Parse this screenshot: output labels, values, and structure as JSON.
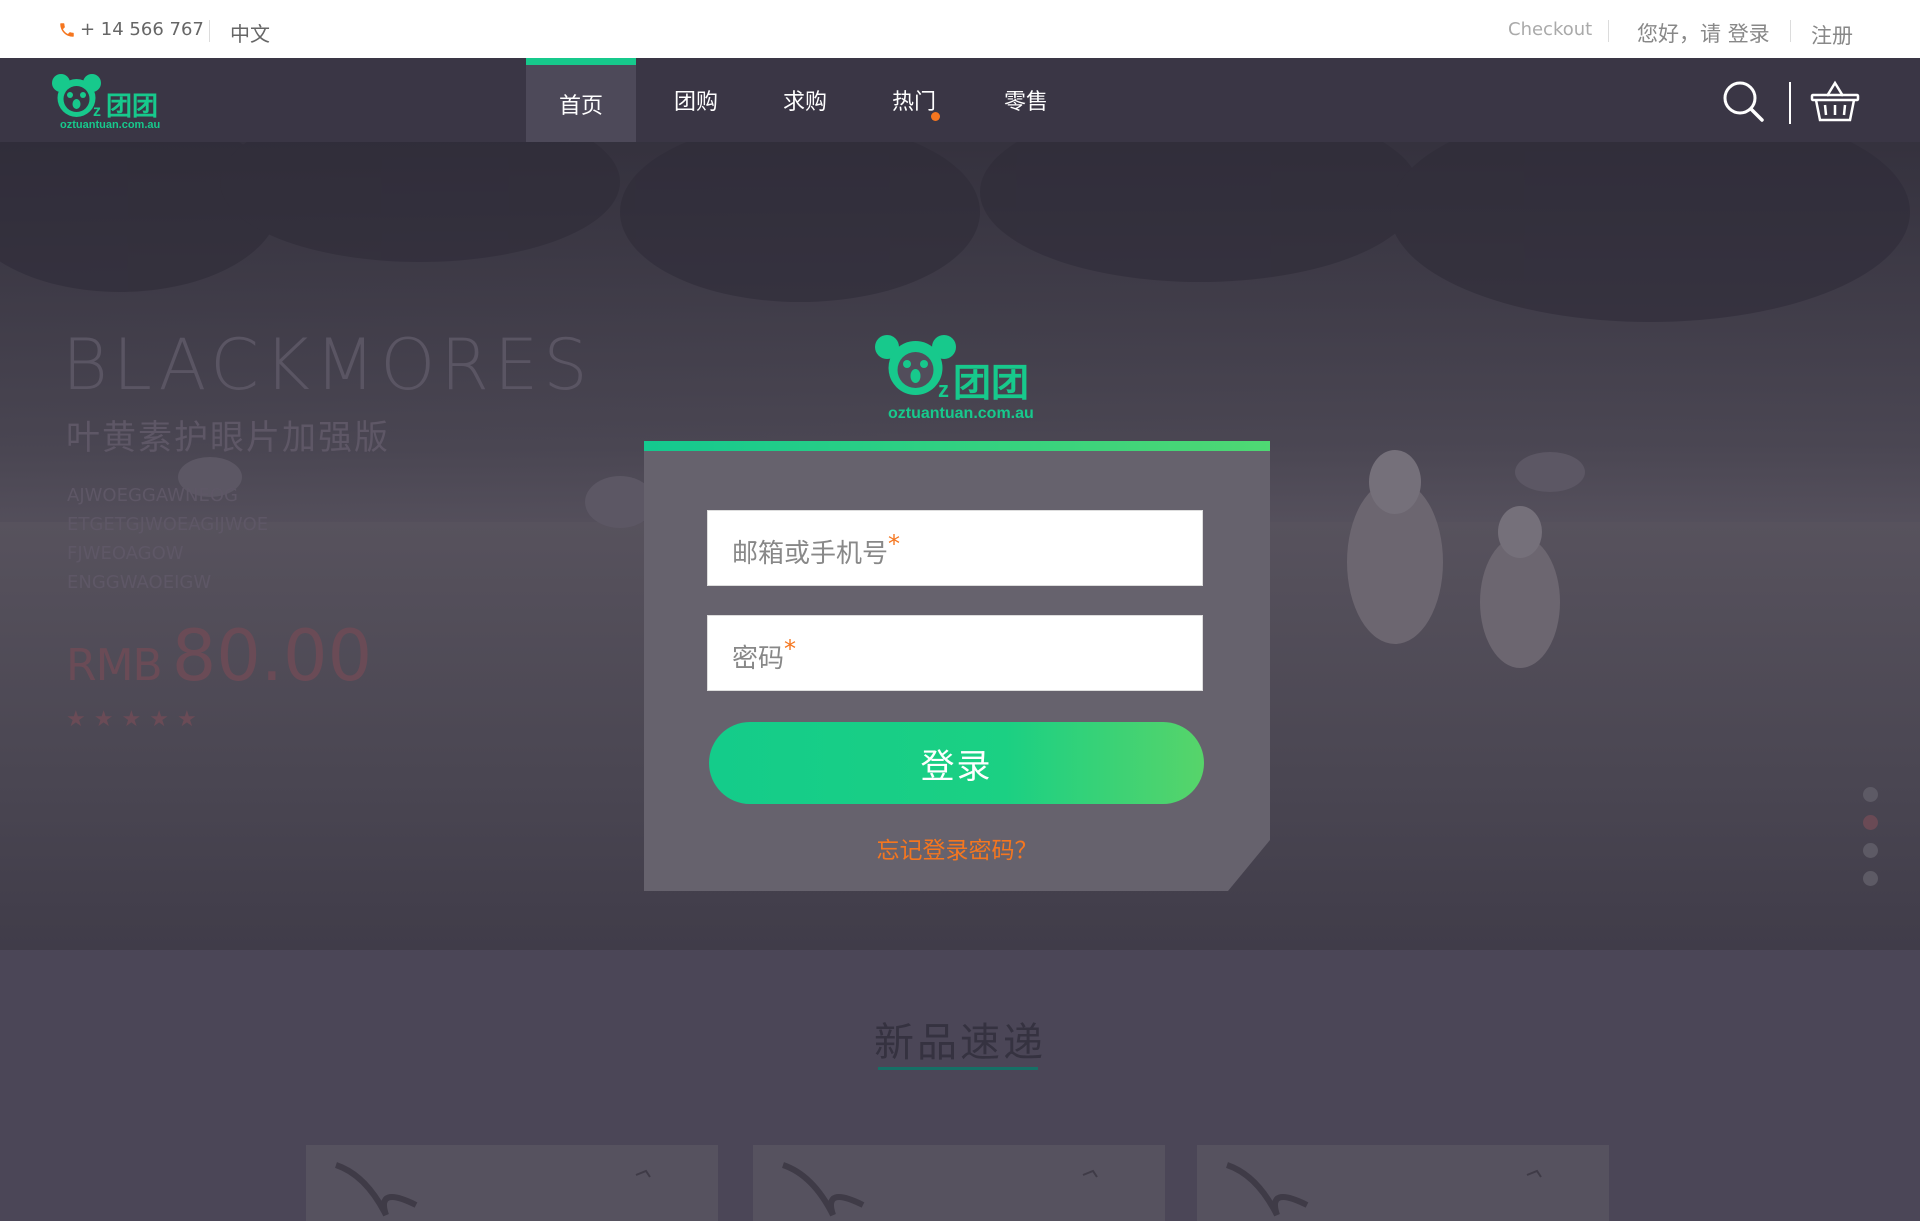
{
  "topbar": {
    "phone": "+ 14 566 767",
    "language": "中文",
    "checkout": "Checkout",
    "greeting": "您好，请",
    "login": "登录",
    "register": "注册"
  },
  "logo": {
    "site": "oztuantuan.com.au",
    "name": "团团"
  },
  "nav": {
    "items": [
      {
        "label": "首页",
        "active": true
      },
      {
        "label": "团购",
        "active": false
      },
      {
        "label": "求购",
        "active": false
      },
      {
        "label": "热门",
        "active": false,
        "badge": true
      },
      {
        "label": "零售",
        "active": false
      }
    ],
    "search_icon": "search-icon",
    "cart_icon": "basket-icon"
  },
  "promo": {
    "brand": "BLACKMORES",
    "product": "叶黄素护眼片加强版",
    "codes": [
      "AJWOEGGAWNEOG",
      "ETGETGJWOEAGIJWOE",
      "FJWEOAGOW",
      "ENGGWAOEIGW"
    ],
    "currency": "RMB",
    "price": "80.00",
    "rating": 5
  },
  "carousel": {
    "count": 4,
    "active_index": 1
  },
  "login": {
    "email_placeholder": "邮箱或手机号",
    "password_placeholder": "密码",
    "required_mark": "*",
    "submit": "登录",
    "forgot": "忘记登录密码？"
  },
  "section": {
    "title": "新品速递"
  },
  "colors": {
    "brand_green": "#17c98c",
    "accent_orange": "#f5761f",
    "nav_bg": "#3a3645"
  }
}
